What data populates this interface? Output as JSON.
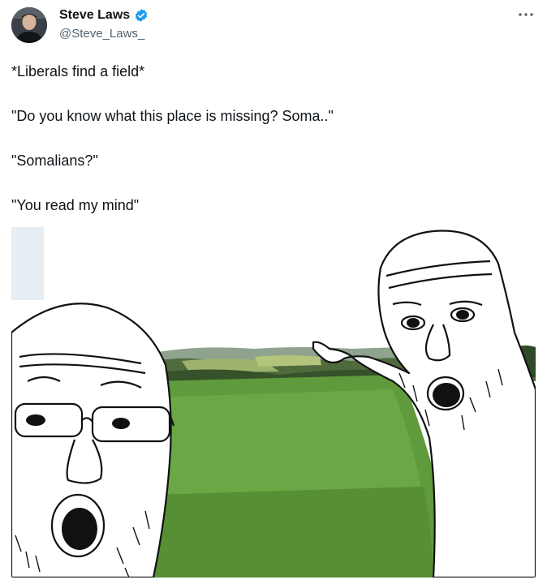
{
  "author": {
    "display_name": "Steve Laws",
    "handle": "@Steve_Laws_",
    "verified": true,
    "verified_color": "#1d9bf0"
  },
  "more_icon": "more-horizontal-icon",
  "tweet_text": [
    "*Liberals find a field*",
    "\"Do you know what this place is missing? Soma..\"",
    "\"Somalians?\"",
    "\"You read my mind\""
  ],
  "media": {
    "kind": "meme-image",
    "description_icons": [
      "soyjak-glasses-figure",
      "soyjak-pointing-figure",
      "green-field"
    ]
  }
}
